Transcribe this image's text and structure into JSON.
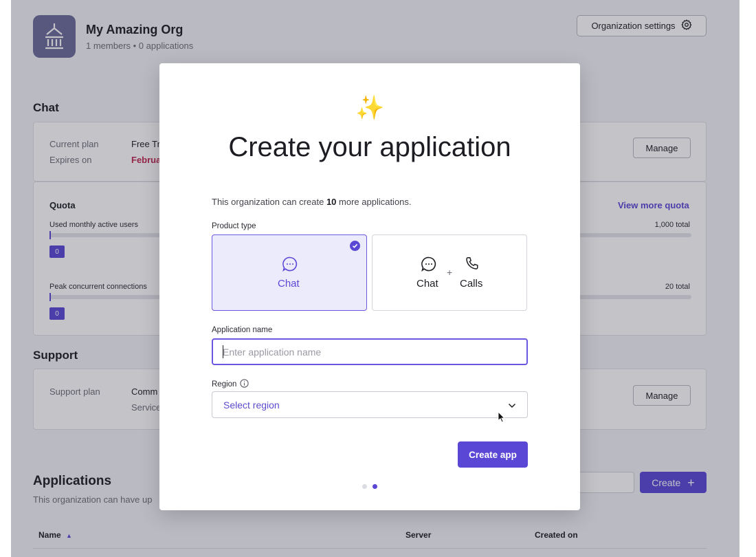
{
  "org": {
    "name": "My Amazing Org",
    "meta": "1 members  •  0 applications",
    "settings_label": "Organization settings"
  },
  "chat_section": {
    "title": "Chat",
    "plan_label": "Current plan",
    "plan_value": "Free Tr",
    "expires_label": "Expires on",
    "expires_value": "Februa",
    "manage_label": "Manage",
    "quota": {
      "title": "Quota",
      "view_more": "View more quota",
      "mau_label": "Used monthly active users",
      "mau_value": "0",
      "mau_total": "1,000 total",
      "mau_fraction": 0,
      "pcc_label": "Peak concurrent connections",
      "pcc_value": "0",
      "pcc_total": "20 total",
      "pcc_fraction": 0
    }
  },
  "support_section": {
    "title": "Support",
    "plan_label": "Support plan",
    "plan_value": "Comm",
    "plan_sub": "Service",
    "manage_label": "Manage"
  },
  "applications": {
    "title": "Applications",
    "subtitle": "This organization can have up",
    "create_label": "Create",
    "columns": [
      "Name",
      "Server",
      "Created on"
    ]
  },
  "modal": {
    "emoji": "✨",
    "title": "Create your application",
    "intro_prefix": "This organization can create ",
    "intro_count": "10",
    "intro_suffix": " more applications.",
    "product_type_label": "Product type",
    "product_types": [
      {
        "label": "Chat",
        "selected": true
      },
      {
        "label_chat": "Chat",
        "label_calls": "Calls",
        "plus": "+",
        "selected": false
      }
    ],
    "app_name_label": "Application name",
    "app_name_placeholder": "Enter application name",
    "app_name_value": "",
    "region_label": "Region",
    "region_placeholder": "Select region",
    "submit_label": "Create app",
    "steps_total": 2,
    "step_current": 2
  },
  "colors": {
    "accent": "#5b47d6",
    "selected_bg": "#ecebfc",
    "logo_bg": "#6b6b9a"
  }
}
